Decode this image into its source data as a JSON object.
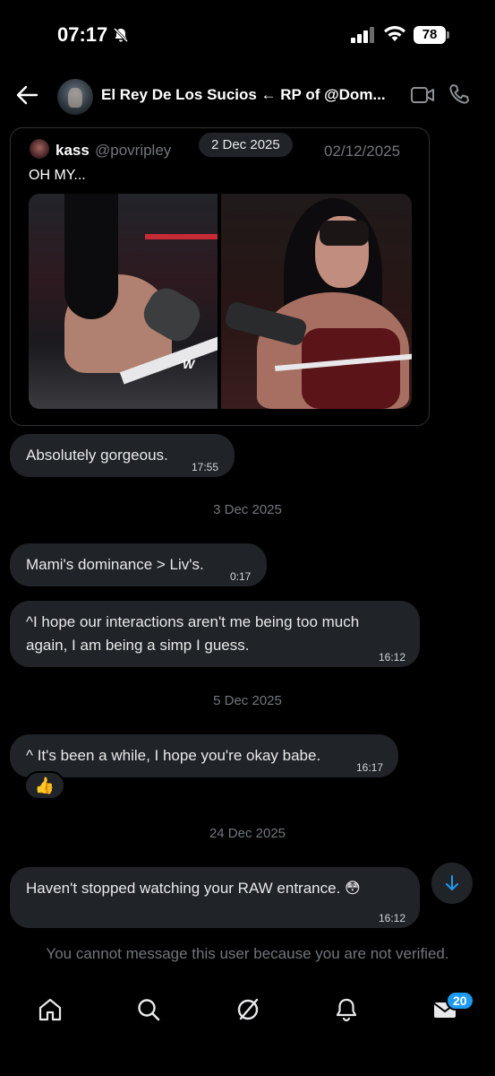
{
  "status_bar": {
    "time": "07:17",
    "battery": "78"
  },
  "header": {
    "title": "El Rey De Los Sucios ← RP of @Dom..."
  },
  "quoted_post": {
    "author_name": "kass",
    "author_handle": "@povripley",
    "post_date": "02/12/2025",
    "text": "OH MY..."
  },
  "date_chip": "2 Dec 2025",
  "messages": [
    {
      "text": "Absolutely gorgeous.",
      "time": "17:55"
    },
    {
      "separator": "3 Dec 2025"
    },
    {
      "text": "Mami's dominance > Liv's.",
      "time": "0:17"
    },
    {
      "text_line1": "^I hope our interactions aren't me being too much",
      "text_line2": "again, I am being a simp I guess.",
      "time": "16:12"
    },
    {
      "separator": "5 Dec 2025"
    },
    {
      "text": "^ It's been a while, I hope you're okay babe.",
      "time": "16:17",
      "reaction": "👍"
    },
    {
      "separator": "24 Dec 2025"
    },
    {
      "text": "Haven't stopped watching your RAW entrance. 😳",
      "time": "16:12"
    }
  ],
  "notice": "You cannot message this user because you are not verified.",
  "nav": {
    "messages_badge": "20"
  },
  "colors": {
    "bubble": "#202327",
    "accent": "#1d9bf0",
    "muted": "#71767b"
  }
}
